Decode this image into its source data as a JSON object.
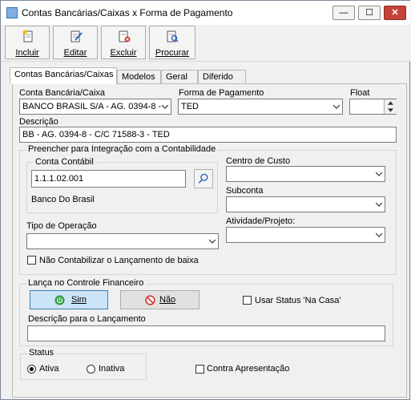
{
  "window": {
    "title": "Contas Bancárias/Caixas x Forma de Pagamento",
    "minimize": "—",
    "maximize": "☐",
    "close": "✕"
  },
  "toolbar": {
    "incluir": "Incluir",
    "editar": "Editar",
    "excluir": "Excluir",
    "procurar": "Procurar"
  },
  "tabs": [
    "Contas Bancárias/Caixas",
    "Modelos",
    "Geral",
    "Diferido"
  ],
  "form": {
    "conta_label": "Conta Bancária/Caixa",
    "conta_value": "BANCO BRASIL S/A - AG. 0394-8 -",
    "forma_label": "Forma de Pagamento",
    "forma_value": "TED",
    "float_label": "Float",
    "float_value": "",
    "descricao_label": "Descrição",
    "descricao_value": "BB - AG. 0394-8 - C/C 71588-3 - TED"
  },
  "contabilidade": {
    "title": "Preencher para Integração com a Contabilidade",
    "conta_contabil_label": "Conta Contábil",
    "conta_contabil_value": "1.1.1.02.001",
    "conta_contabil_desc": "Banco Do Brasil",
    "centro_custo_label": "Centro de Custo",
    "centro_custo_value": "",
    "subconta_label": "Subconta",
    "subconta_value": "",
    "tipo_operacao_label": "Tipo de Operação",
    "tipo_operacao_value": "",
    "atividade_label": "Atividade/Projeto:",
    "atividade_value": "",
    "nao_contabilizar_label": "Não Contabilizar o Lançamento de baixa"
  },
  "controle": {
    "title": "Lança no Controle Financeiro",
    "sim_label": "Sim",
    "nao_label": "Não",
    "usar_status_label": "Usar Status 'Na Casa'",
    "descricao_lancamento_label": "Descrição para o Lançamento",
    "descricao_lancamento_value": ""
  },
  "status": {
    "title": "Status",
    "ativa_label": "Ativa",
    "inativa_label": "Inativa",
    "contra_apresentacao_label": "Contra Apresentação"
  }
}
